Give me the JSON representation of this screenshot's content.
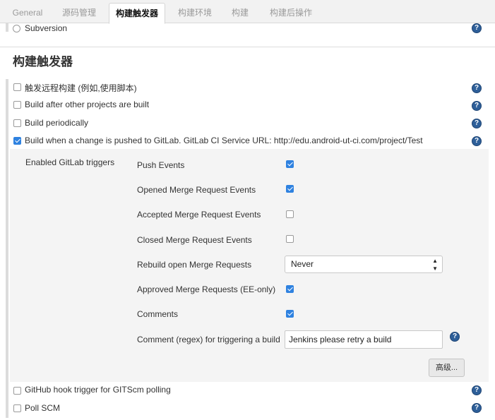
{
  "tabs": [
    "General",
    "源码管理",
    "构建触发器",
    "构建环境",
    "构建",
    "构建后操作"
  ],
  "scm_option": {
    "label": "Subversion",
    "selected": false
  },
  "section_title": "构建触发器",
  "triggers": [
    {
      "label": "触发远程构建 (例如,使用脚本)",
      "checked": false
    },
    {
      "label": "Build after other projects are built",
      "checked": false
    },
    {
      "label": "Build periodically",
      "checked": false
    },
    {
      "label": "Build when a change is pushed to GitLab. GitLab CI Service URL: http://edu.android-ut-ci.com/project/Test",
      "checked": true
    }
  ],
  "gitlab": {
    "group_label": "Enabled GitLab triggers",
    "push_events": {
      "label": "Push Events",
      "checked": true
    },
    "opened_mr_events": {
      "label": "Opened Merge Request Events",
      "checked": true
    },
    "accepted_mr_events": {
      "label": "Accepted Merge Request Events",
      "checked": false
    },
    "closed_mr_events": {
      "label": "Closed Merge Request Events",
      "checked": false
    },
    "rebuild_open_mr": {
      "label": "Rebuild open Merge Requests",
      "selected": "Never"
    },
    "approved_mr": {
      "label": "Approved Merge Requests (EE-only)",
      "checked": true
    },
    "comments": {
      "label": "Comments",
      "checked": true
    },
    "comment_regex": {
      "label": "Comment (regex) for triggering a build",
      "value": "Jenkins please retry a build"
    },
    "advanced_button": "高级..."
  },
  "more_triggers": [
    {
      "label": "GitHub hook trigger for GITScm polling",
      "checked": false
    },
    {
      "label": "Poll SCM",
      "checked": false
    }
  ],
  "icons": {
    "help": "help-icon",
    "select_arrows": "updown-arrows-icon"
  },
  "colors": {
    "checkbox_checked": "#2f82e0",
    "help_icon": "#2e5f99"
  }
}
